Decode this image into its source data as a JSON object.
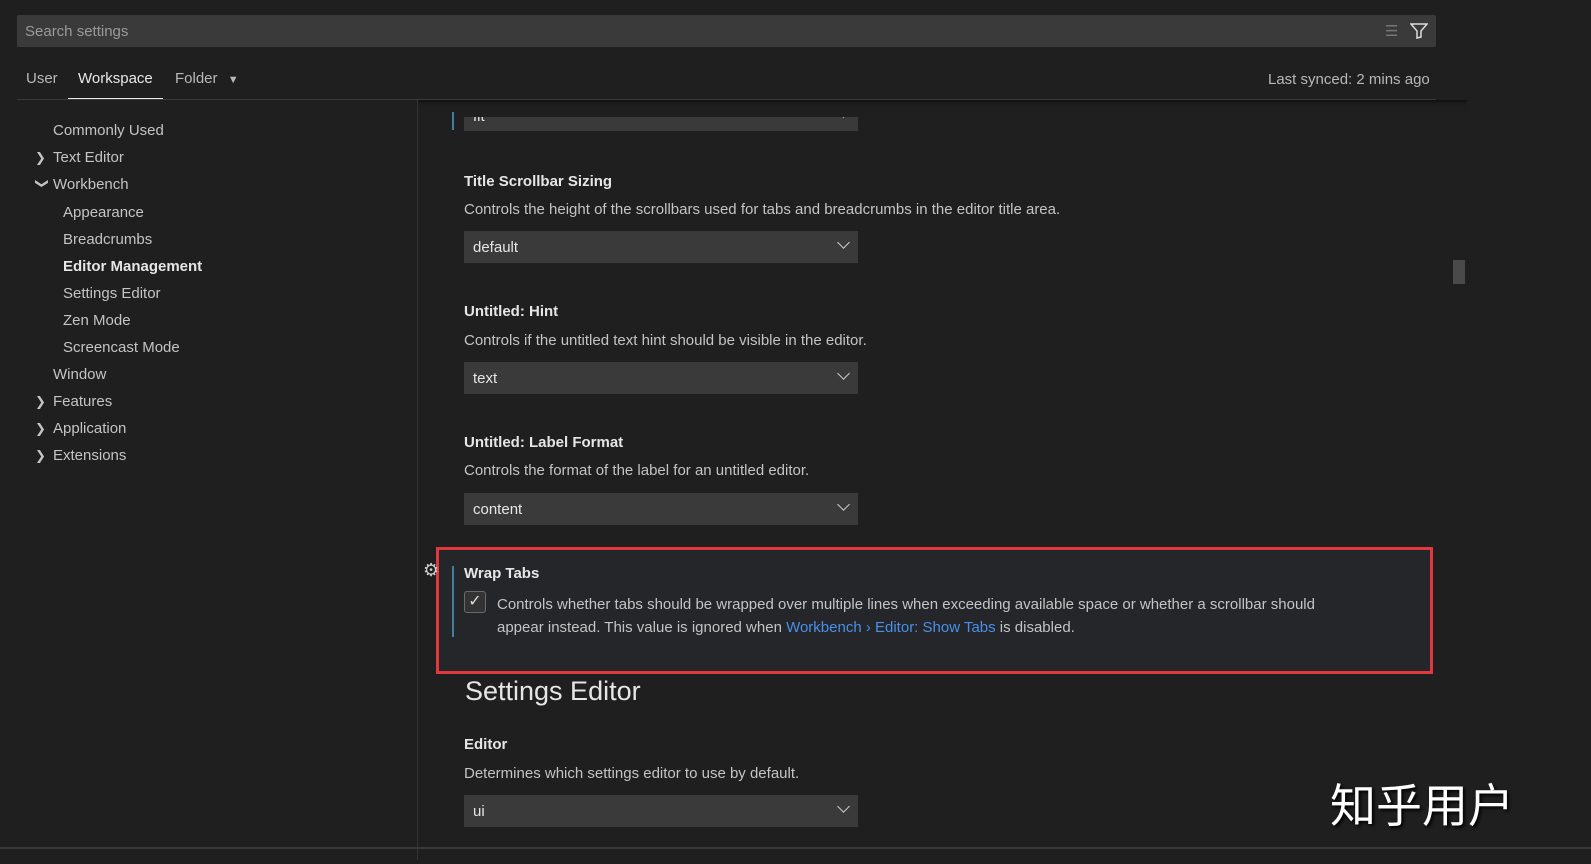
{
  "search": {
    "placeholder": "Search settings"
  },
  "tabs": [
    {
      "label": "User"
    },
    {
      "label": "Workspace"
    },
    {
      "label": "Folder"
    }
  ],
  "last_synced": "Last synced: 2 mins ago",
  "toc": [
    {
      "label": "Commonly Used"
    },
    {
      "label": "Text Editor"
    },
    {
      "label": "Workbench"
    },
    {
      "label": "Appearance"
    },
    {
      "label": "Breadcrumbs"
    },
    {
      "label": "Editor Management"
    },
    {
      "label": "Settings Editor"
    },
    {
      "label": "Zen Mode"
    },
    {
      "label": "Screencast Mode"
    },
    {
      "label": "Window"
    },
    {
      "label": "Features"
    },
    {
      "label": "Application"
    },
    {
      "label": "Extensions"
    }
  ],
  "settings": {
    "partial": {
      "value": "fit"
    },
    "title_scrollbar": {
      "title": "Title Scrollbar Sizing",
      "desc": "Controls the height of the scrollbars used for tabs and breadcrumbs in the editor title area.",
      "value": "default"
    },
    "untitled_hint": {
      "cat": "Untitled: ",
      "title": "Hint",
      "desc": "Controls if the untitled text hint should be visible in the editor.",
      "value": "text"
    },
    "untitled_label": {
      "cat": "Untitled: ",
      "title": "Label Format",
      "desc": "Controls the format of the label for an untitled editor.",
      "value": "content"
    },
    "wrap_tabs": {
      "title": "Wrap Tabs",
      "checked": true,
      "check": "✓",
      "desc1": "Controls whether tabs should be wrapped over multiple lines when exceeding available space or whether a scrollbar should",
      "desc2": "appear instead. This value is ignored when ",
      "link": "Workbench › Editor: Show Tabs",
      "desc3": " is disabled."
    },
    "section": "Settings Editor",
    "editor": {
      "title": "Editor",
      "desc": "Determines which settings editor to use by default.",
      "value": "ui"
    }
  },
  "watermark": "知乎用户"
}
